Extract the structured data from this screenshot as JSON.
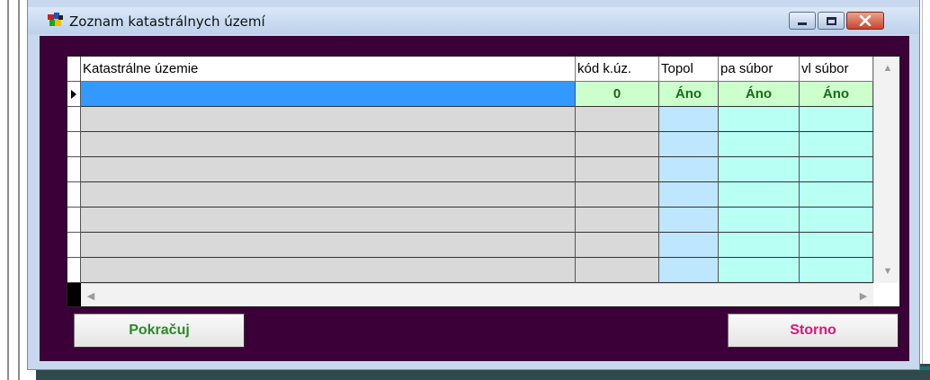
{
  "window": {
    "title": "Zoznam katastrálnych území",
    "icon": "application-icon",
    "controls": {
      "minimize": "minimize-icon",
      "maximize": "maximize-icon",
      "close": "close-icon"
    }
  },
  "grid": {
    "columns": [
      {
        "key": "name",
        "label": "Katastrálne územie"
      },
      {
        "key": "code",
        "label": "kód k.úz."
      },
      {
        "key": "topol",
        "label": "Topol"
      },
      {
        "key": "pa",
        "label": "pa súbor"
      },
      {
        "key": "vl",
        "label": "vl súbor"
      }
    ],
    "rows": [
      {
        "name": "",
        "code": "0",
        "topol": "Áno",
        "pa": "Áno",
        "vl": "Áno"
      },
      {
        "name": "",
        "code": "",
        "topol": "",
        "pa": "",
        "vl": ""
      },
      {
        "name": "",
        "code": "",
        "topol": "",
        "pa": "",
        "vl": ""
      },
      {
        "name": "",
        "code": "",
        "topol": "",
        "pa": "",
        "vl": ""
      },
      {
        "name": "",
        "code": "",
        "topol": "",
        "pa": "",
        "vl": ""
      },
      {
        "name": "",
        "code": "",
        "topol": "",
        "pa": "",
        "vl": ""
      },
      {
        "name": "",
        "code": "",
        "topol": "",
        "pa": "",
        "vl": ""
      },
      {
        "name": "",
        "code": "",
        "topol": "",
        "pa": "",
        "vl": ""
      }
    ],
    "current_row_indicator": "row-pointer-icon"
  },
  "buttons": {
    "continue_label": "Pokračuj",
    "cancel_label": "Storno"
  },
  "colors": {
    "client_bg": "#3a0037",
    "selected_row": "#3399ff",
    "continue_text": "#2a8a2a",
    "cancel_text": "#e0137a"
  }
}
